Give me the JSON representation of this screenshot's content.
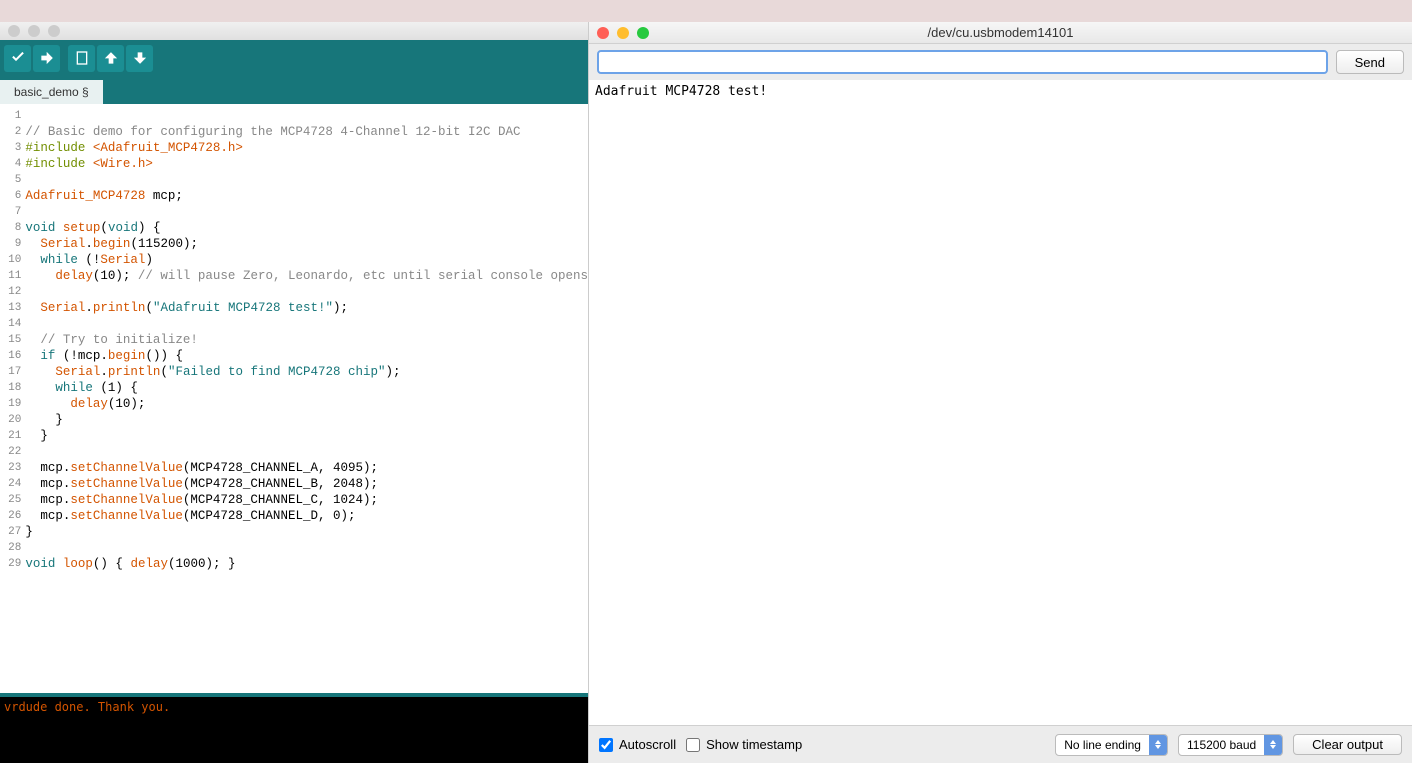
{
  "arduino": {
    "tab_name": "basic_demo §",
    "toolbar_icons": [
      "verify-icon",
      "upload-icon",
      "new-icon",
      "open-icon",
      "save-icon"
    ],
    "code_lines": [
      {
        "n": "1",
        "html": ""
      },
      {
        "n": "2",
        "html": "<span class='tok-comment'>// Basic demo for configuring the MCP4728 4-Channel 12-bit I2C DAC</span>"
      },
      {
        "n": "3",
        "html": "<span class='tok-include'>#include</span> <span class='tok-func'>&lt;Adafruit_MCP4728.h&gt;</span>"
      },
      {
        "n": "4",
        "html": "<span class='tok-include'>#include</span> <span class='tok-func'>&lt;Wire.h&gt;</span>"
      },
      {
        "n": "5",
        "html": ""
      },
      {
        "n": "6",
        "html": "<span class='tok-ident'>Adafruit_MCP4728</span> mcp;"
      },
      {
        "n": "7",
        "html": ""
      },
      {
        "n": "8",
        "html": "<span class='tok-keyword'>void</span> <span class='tok-func'>setup</span>(<span class='tok-keyword'>void</span>) {"
      },
      {
        "n": "9",
        "html": "  <span class='tok-ident'>Serial</span>.<span class='tok-func'>begin</span>(115200);"
      },
      {
        "n": "10",
        "html": "  <span class='tok-keyword'>while</span> (!<span class='tok-ident'>Serial</span>)"
      },
      {
        "n": "11",
        "html": "    <span class='tok-func'>delay</span>(10); <span class='tok-comment'>// will pause Zero, Leonardo, etc until serial console opens</span>"
      },
      {
        "n": "12",
        "html": ""
      },
      {
        "n": "13",
        "html": "  <span class='tok-ident'>Serial</span>.<span class='tok-func'>println</span>(<span class='tok-string'>\"Adafruit MCP4728 test!\"</span>);"
      },
      {
        "n": "14",
        "html": ""
      },
      {
        "n": "15",
        "html": "  <span class='tok-comment'>// Try to initialize!</span>"
      },
      {
        "n": "16",
        "html": "  <span class='tok-keyword'>if</span> (!mcp.<span class='tok-func'>begin</span>()) {"
      },
      {
        "n": "17",
        "html": "    <span class='tok-ident'>Serial</span>.<span class='tok-func'>println</span>(<span class='tok-string'>\"Failed to find MCP4728 chip\"</span>);"
      },
      {
        "n": "18",
        "html": "    <span class='tok-keyword'>while</span> (1) {"
      },
      {
        "n": "19",
        "html": "      <span class='tok-func'>delay</span>(10);"
      },
      {
        "n": "20",
        "html": "    }"
      },
      {
        "n": "21",
        "html": "  }"
      },
      {
        "n": "22",
        "html": ""
      },
      {
        "n": "23",
        "html": "  mcp.<span class='tok-func'>setChannelValue</span>(MCP4728_CHANNEL_A, 4095);"
      },
      {
        "n": "24",
        "html": "  mcp.<span class='tok-func'>setChannelValue</span>(MCP4728_CHANNEL_B, 2048);"
      },
      {
        "n": "25",
        "html": "  mcp.<span class='tok-func'>setChannelValue</span>(MCP4728_CHANNEL_C, 1024);"
      },
      {
        "n": "26",
        "html": "  mcp.<span class='tok-func'>setChannelValue</span>(MCP4728_CHANNEL_D, 0);"
      },
      {
        "n": "27",
        "html": "}"
      },
      {
        "n": "28",
        "html": ""
      },
      {
        "n": "29",
        "html": "<span class='tok-keyword'>void</span> <span class='tok-func'>loop</span>() { <span class='tok-func'>delay</span>(1000); }"
      }
    ],
    "console_text": "vrdude done.  Thank you."
  },
  "serial": {
    "title": "/dev/cu.usbmodem14101",
    "input_value": "",
    "send_label": "Send",
    "output_text": "Adafruit MCP4728 test!",
    "autoscroll_label": "Autoscroll",
    "autoscroll_checked": true,
    "timestamp_label": "Show timestamp",
    "timestamp_checked": false,
    "line_ending": "No line ending",
    "baud": "115200 baud",
    "clear_label": "Clear output"
  }
}
